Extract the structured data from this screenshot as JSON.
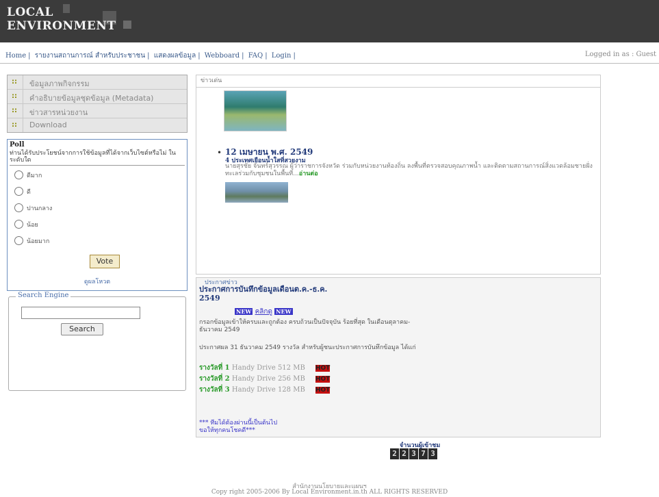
{
  "header": {
    "logo_line1": "LOCAL",
    "logo_line2": "ENVIRONMENT"
  },
  "nav": {
    "links": [
      "Home",
      "รายงานสถานการณ์ สำหรับประชาชน",
      "แสดงผลข้อมูล",
      "Webboard",
      "FAQ",
      "Login"
    ],
    "logged_in": "Logged in as : Guest"
  },
  "menu": {
    "items": [
      "ข้อมูลภาพกิจกรรม",
      "คำอธิบายข้อมูลชุดข้อมูล (Metadata)",
      "ข่าวสารหน่วยงาน",
      "Download"
    ]
  },
  "poll": {
    "title": "Poll",
    "question": "ท่านได้รับประโยชน์จากการใช้ข้อมูลที่ได้จากเว็บไซต์หรือไม่ ในระดับใด",
    "options": [
      "ดีมาก",
      "ดี",
      "ปานกลาง",
      "น้อย",
      "น้อยมาก"
    ],
    "vote_label": "Vote",
    "results_label": "ดูผลโหวต"
  },
  "search": {
    "legend": "Search Engine",
    "button": "Search",
    "value": ""
  },
  "news": {
    "header": "ข่าวเด่น",
    "date": "12 เมษายน พ.ศ. 2549",
    "title": "4 ประเทศเยือนน้ำใสที่สวยงาม",
    "body": "นายสุรชัย จันทร์สุวรรณ ผู้ว่าราชการจังหวัด ร่วมกับหน่วยงานท้องถิ่น ลงพื้นที่ตรวจสอบคุณภาพน้ำ และติดตามสถานการณ์สิ่งแวดล้อมชายฝั่งทะเลร่วมกับชุมชนในพื้นที่...",
    "more": "อ่านต่อ"
  },
  "announcement": {
    "legend": "ประกาศข่าว",
    "title": "ประกาศการบันทึกข้อมูลเดือนต.ค.-ธ.ค. 2549",
    "badge_new": "NEW",
    "badge_link": "คลิกดู",
    "text1": "กรอกข้อมูลเข้าให้ครบและถูกต้อง ครบถ้วนเป็นปัจจุบัน ร้อยที่สุด ในเดือนตุลาคม-ธันวาคม 2549",
    "text2": "ประกาศผล 31 ธันวาคม 2549 รางวัล สำหรับผู้ชนะประกาศการบันทึกข้อมูล ได้แก่",
    "prizes": [
      {
        "label": "รางวัลที่ 1",
        "item": "Handy Drive 512 MB",
        "hot": "HOT"
      },
      {
        "label": "รางวัลที่ 2",
        "item": "Handy Drive 256 MB",
        "hot": "HOT"
      },
      {
        "label": "รางวัลที่ 3",
        "item": "Handy Drive 128 MB",
        "hot": "HOT"
      }
    ],
    "foot1": "*** ทีมได้ต้องผ่านนี้เป็นต้นไป",
    "foot2": "ขอให้ทุกคนโชคดี***"
  },
  "counter": {
    "label": "จำนวนผู้เข้าชม",
    "digits": [
      "2",
      "2",
      "3",
      "7",
      "3"
    ]
  },
  "footer": {
    "line1": "สำนักงานนโยบายและแผนฯ",
    "line2": "Copy right 2005-2006 By Local Environment.in.th ALL RIGHTS RESERVED"
  }
}
